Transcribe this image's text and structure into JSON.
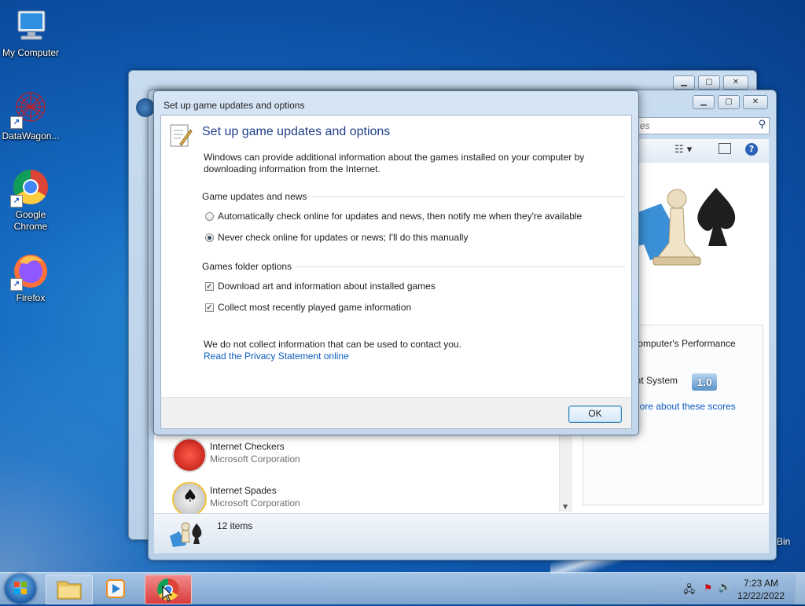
{
  "desktop": {
    "icons": [
      {
        "label": "My Computer",
        "icon": "computer-icon"
      },
      {
        "label": "DataWagon...",
        "icon": "datawagon-icon"
      },
      {
        "label": "Google Chrome",
        "icon": "chrome-icon"
      },
      {
        "label": "Firefox",
        "icon": "firefox-icon"
      }
    ],
    "recycle_label": "Bin"
  },
  "games_window": {
    "search_placeholder": "es",
    "list": [
      {
        "name": "Internet Checkers",
        "publisher": "Microsoft Corporation",
        "icon": "checkers-icon"
      },
      {
        "name": "Internet Spades",
        "publisher": "Microsoft Corporation",
        "icon": "spades-icon"
      }
    ],
    "status_count": "12 items",
    "perf": {
      "line1": "r computer's Performance",
      "line2": "n:",
      "system_label": "rent System",
      "score": "1.0",
      "link": "nore about these scores"
    }
  },
  "dialog": {
    "title": "Set up game updates and options",
    "heading": "Set up game updates and options",
    "description": "Windows can provide additional information about the games installed on your computer by downloading information from the Internet.",
    "group1_label": "Game updates and news",
    "radio1": "Automatically check online for updates and news, then notify me when they're available",
    "radio2": "Never check online for updates or news; I'll do this manually",
    "radio_selected": 2,
    "group2_label": "Games folder options",
    "check1": "Download art and information about installed games",
    "check2": "Collect most recently played game information",
    "check1_on": true,
    "check2_on": true,
    "privacy_text": "We do not collect information that can be used to contact you.",
    "privacy_link": "Read the Privacy Statement online",
    "ok_label": "OK"
  },
  "taskbar": {
    "items": [
      "start-button",
      "file-explorer",
      "media-player",
      "chrome"
    ],
    "time": "7:23 AM",
    "date": "12/22/2022"
  },
  "colors": {
    "desktop": "#1569c0",
    "link": "#0b5bbd",
    "heading": "#1e3f8a"
  }
}
